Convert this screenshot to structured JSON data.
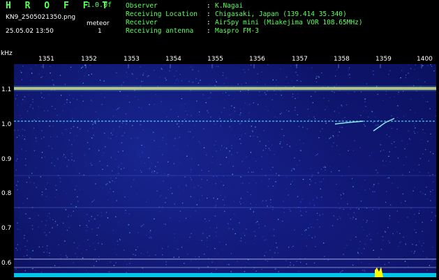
{
  "header": {
    "brand": "H R O F F T",
    "version": "1.0.0f",
    "filename": "KN9_2505021350.png",
    "datetime": "25.05.02 13:50",
    "mode_label": "meteor",
    "mode_value": "1",
    "info": [
      {
        "key": "Observer",
        "value": "K.Nagai"
      },
      {
        "key": "Receiving Location",
        "value": "Chigasaki, Japan (139.414 35.340)"
      },
      {
        "key": "Receiver",
        "value": "AirSpy mini (Miakejima VOR 108.65MHz)"
      },
      {
        "key": "Receiving antenna",
        "value": "Maspro FM-3"
      }
    ],
    "separator": ":"
  },
  "axis": {
    "unit": "kHz",
    "time_ticks": [
      "1351",
      "1352",
      "1353",
      "1354",
      "1355",
      "1356",
      "1357",
      "1358",
      "1359",
      "1400"
    ],
    "freq_ticks": [
      "1.1",
      "1.0",
      "0.9",
      "0.8",
      "0.7",
      "0.6"
    ]
  },
  "colors": {
    "background": "#0b1160",
    "trace_main": "#ffd84a",
    "trace_secondary": "#4fd8ff",
    "text_green": "#5cff5c",
    "baseline": "#00e5ff",
    "marker": "#ffff00"
  }
}
